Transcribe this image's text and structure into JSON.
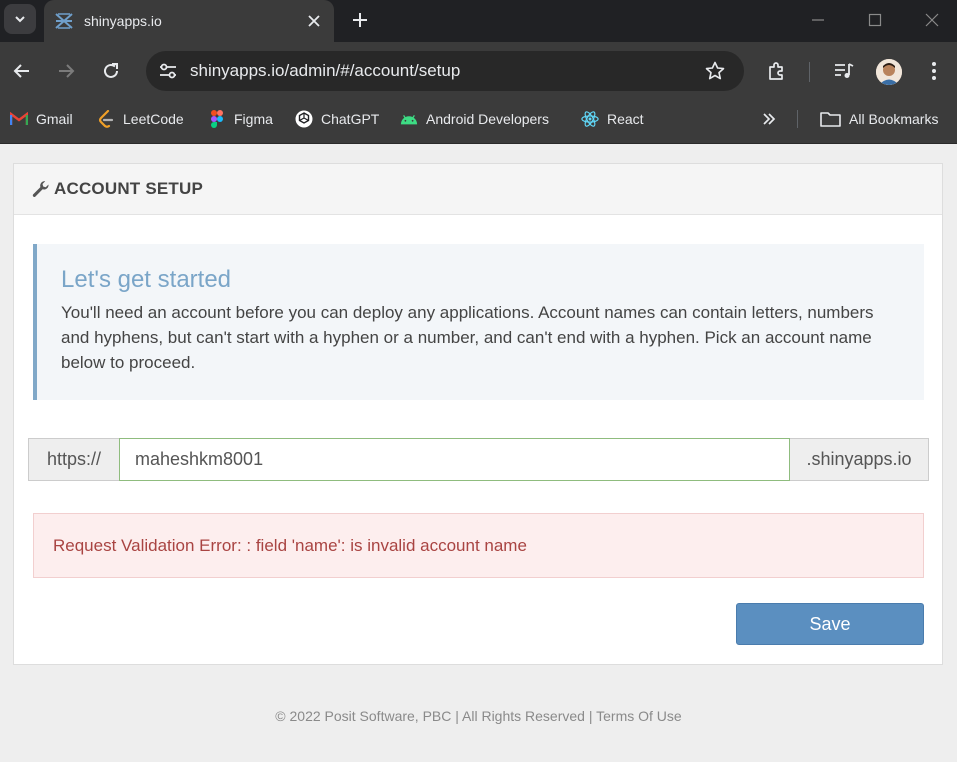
{
  "browser": {
    "tab_title": "shinyapps.io",
    "url": "shinyapps.io/admin/#/account/setup",
    "bookmarks": [
      {
        "label": "Gmail",
        "icon": "gmail-icon"
      },
      {
        "label": "LeetCode",
        "icon": "leetcode-icon"
      },
      {
        "label": "Figma",
        "icon": "figma-icon"
      },
      {
        "label": "ChatGPT",
        "icon": "chatgpt-icon"
      },
      {
        "label": "Android Developers",
        "icon": "android-icon"
      },
      {
        "label": "React",
        "icon": "react-icon"
      }
    ],
    "all_bookmarks_label": "All Bookmarks"
  },
  "panel": {
    "title": "ACCOUNT SETUP"
  },
  "intro": {
    "heading": "Let's get started",
    "body": "You'll need an account before you can deploy any applications. Account names can contain letters, numbers and hyphens, but can't start with a hyphen or a number, and can't end with a hyphen. Pick an account name below to proceed."
  },
  "account_form": {
    "prefix": "https://",
    "name_value": "maheshkm8001",
    "suffix": ".shinyapps.io",
    "save_label": "Save"
  },
  "error": {
    "message": "Request Validation Error: : field 'name': is invalid account name"
  },
  "footer": {
    "copyright": "© 2022 Posit Software, PBC | All Rights Reserved |",
    "terms_label": "Terms Of Use"
  },
  "colors": {
    "accent": "#5b8fc0",
    "callout_border": "#80a8c8",
    "error_text": "#a94442",
    "error_bg": "#fdeeee",
    "input_border": "#8fbc7e"
  }
}
